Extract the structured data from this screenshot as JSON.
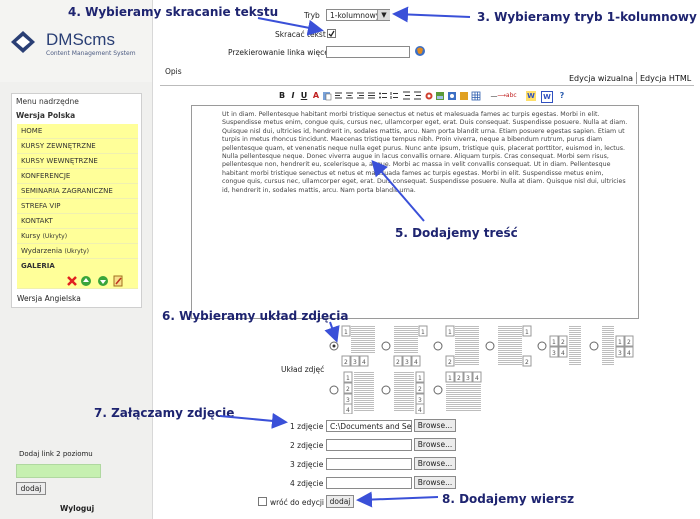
{
  "sidebar": {
    "logo_name": "DMScms",
    "logo_sub": "Content Management System",
    "menu_heading": "Menu nadrzędne",
    "version_pl": "Wersja Polska",
    "items": [
      {
        "label": "HOME",
        "suffix": ""
      },
      {
        "label": "KURSY ZEWNĘTRZNE",
        "suffix": ""
      },
      {
        "label": "KURSY WEWNĘTRZNE",
        "suffix": ""
      },
      {
        "label": "KONFERENCJE",
        "suffix": ""
      },
      {
        "label": "SEMINARIA ZAGRANICZNE",
        "suffix": ""
      },
      {
        "label": "STREFA VIP",
        "suffix": ""
      },
      {
        "label": "KONTAKT",
        "suffix": ""
      },
      {
        "label": "Kursy",
        "suffix": "(Ukryty)"
      },
      {
        "label": "Wydarzenia",
        "suffix": "(Ukryty)"
      },
      {
        "label": "GALERIA",
        "suffix": ""
      }
    ],
    "version_en": "Wersja Angielska",
    "add_level2_label": "Dodaj link 2 poziomu",
    "add_button": "dodaj",
    "logout": "Wyloguj"
  },
  "form": {
    "tryb_label": "Tryb",
    "tryb_value": "1-kolumnowy",
    "skracac_label": "Skracać tekst",
    "przekierowanie_label": "Przekierowanie linka więcej",
    "opis_label": "Opis",
    "tab_visual": "Edycja wizualna",
    "tab_html": "Edycja HTML",
    "editor_text": "Ut in diam. Pellentesque habitant morbi tristique senectus et netus et malesuada fames ac turpis egestas. Morbi in elit. Suspendisse metus enim, congue quis, cursus nec, ullamcorper eget, erat. Duis consequat. Suspendisse posuere. Nulla at diam. Quisque nisl dui, ultricies id, hendrerit in, sodales mattis, arcu. Nam porta blandit urna. Etiam posuere egestas sapien. Etiam ut turpis in metus rhoncus tincidunt. Maecenas tristique tempus nibh. Proin viverra, neque a bibendum rutrum, purus diam pellentesque quam, et venenatis neque nulla eget purus. Nunc ante ipsum, tristique quis, placerat porttitor, euismod in, lectus. Nulla pellentesque neque. Donec viverra augue in lacus convallis ornare. Aliquam turpis. Cras consequat. Morbi sem risus, pellentesque non, hendrerit eu, scelerisque a, augue. Morbi ac massa in velit convallis consequat. Ut in diam. Pellentesque habitant morbi tristique senectus et netus et malesuada fames ac turpis egestas. Morbi in elit. Suspendisse metus enim, congue quis, cursus nec, ullamcorper eget, erat. Duis consequat. Suspendisse posuere. Nulla at diam. Quisque nisl dui, ultricies id, hendrerit in, sodales mattis, arcu. Nam porta blandit urna.",
    "layout_label": "Układ zdjęć",
    "photo_labels": [
      "1 zdjęcie",
      "2 zdjęcie",
      "3 zdjęcie",
      "4 zdjęcie"
    ],
    "photo1_value": "C:\\Documents and Se",
    "browse": "Browse...",
    "return_label": "wróć do edycji",
    "add_row_button": "dodaj"
  },
  "toolbar_icons": [
    "bold-icon",
    "italic-icon",
    "underline-icon",
    "font-color-icon",
    "paste-icon",
    "align-left-icon",
    "align-center-icon",
    "align-right-icon",
    "align-justify-icon",
    "bullet-list-icon",
    "numbered-list-icon",
    "outdent-icon",
    "indent-icon",
    "link-icon",
    "image-icon",
    "media-icon",
    "insert-icon",
    "table-icon",
    "horizontal-rule-icon",
    "strikethrough-icon",
    "word-paste-icon",
    "word-icon",
    "help-icon"
  ],
  "annotations": {
    "a4": "4. Wybieramy skracanie tekstu",
    "a3": "3. Wybieramy tryb 1-kolumnowy",
    "a5": "5. Dodajemy treść",
    "a6": "6. Wybieramy układ zdjęcia",
    "a7": "7. Załączamy zdjęcie",
    "a8": "8. Dodajemy wiersz"
  },
  "colors": {
    "annotation": "#1e2470",
    "menu_highlight": "#ffff99",
    "add_input": "#c6f0b0"
  }
}
